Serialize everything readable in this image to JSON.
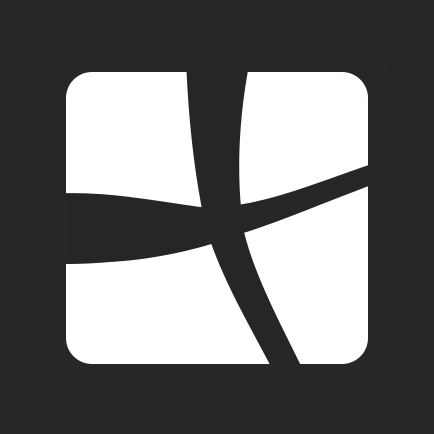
{
  "icon": {
    "name": "app-logo-icon",
    "colors": {
      "background": "#262626",
      "background_shade": "#2d2d2d",
      "tile": "#ffffff",
      "stroke": "#262626"
    }
  }
}
